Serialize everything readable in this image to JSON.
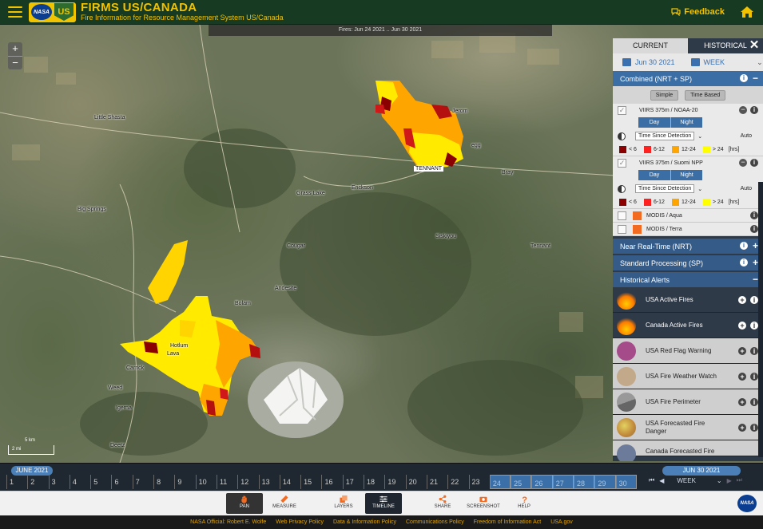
{
  "header": {
    "nasa_logo": "NASA",
    "usfs_logo": "US",
    "title": "FIRMS US/CANADA",
    "subtitle": "Fire Information for Resource Management System US/Canada",
    "feedback": "Feedback"
  },
  "map": {
    "banner": "Fires: Jun 24 2021 .. Jun 30 2021",
    "zoom_in": "+",
    "zoom_out": "−",
    "places": {
      "little_shasta": "Little Shasta",
      "jerom": "Jerom",
      "egg": "egg",
      "bray": "Bray",
      "tennant_label": "TENNANT",
      "grass_lake": "Grass Lake",
      "erickson": "Erickson",
      "big_springs": "Big Springs",
      "siskiyou": "Siskiyou",
      "tennant": "Tennant",
      "cougar": "Cougar",
      "andesite": "Andesite",
      "bolam": "Bolam",
      "hotlum": "Hotlum",
      "lava": "Lava",
      "carrick": "Carrick",
      "weed": "Weed",
      "igerna": "Igerna",
      "deetz": "Deetz"
    },
    "scale_text": "5 km",
    "scale_text2": "2 mi"
  },
  "panel": {
    "tab_current": "CURRENT",
    "tab_historical": "HISTORICAL",
    "close": "✕",
    "date": "Jun 30 2021",
    "period": "WEEK",
    "combined": "Combined (NRT + SP)",
    "btn_simple": "Simple",
    "btn_time_based": "Time Based",
    "layer1": "VIIRS 375m / NOAA-20",
    "layer2": "VIIRS 375m / Suomi NPP",
    "day": "Day",
    "night": "Night",
    "tsd": "Time Since Detection",
    "auto": "Auto",
    "legend": [
      "< 6",
      "6-12",
      "12-24",
      "> 24"
    ],
    "legend_unit": "[hrs]",
    "legend_colors": [
      "#8b0000",
      "#ff2020",
      "#ffa500",
      "#ffff00"
    ],
    "modis_aqua": "MODIS / Aqua",
    "modis_terra": "MODIS / Terra",
    "nrt": "Near Real-Time (NRT)",
    "sp": "Standard Processing (SP)",
    "hist_alerts": "Historical Alerts",
    "alerts": [
      {
        "label": "USA Active Fires"
      },
      {
        "label": "Canada Active Fires"
      },
      {
        "label": "USA Red Flag Warning"
      },
      {
        "label": "USA Fire Weather Watch"
      },
      {
        "label": "USA Fire Perimeter"
      },
      {
        "label": "USA Forecasted Fire Danger"
      },
      {
        "label": "Canada Forecasted Fire"
      }
    ]
  },
  "timeline": {
    "month": "JUNE 2021",
    "days": [
      "1",
      "2",
      "3",
      "4",
      "5",
      "6",
      "7",
      "8",
      "9",
      "10",
      "11",
      "12",
      "13",
      "14",
      "15",
      "16",
      "17",
      "18",
      "19",
      "20",
      "21",
      "22",
      "23",
      "24",
      "25",
      "26",
      "27",
      "28",
      "29",
      "30"
    ],
    "selected_from": 24,
    "date": "JUN 30 2021",
    "period": "WEEK"
  },
  "toolbar": {
    "pan": "PAN",
    "measure": "MEASURE",
    "layers": "LAYERS",
    "timeline": "TIMELINE",
    "share": "SHARE",
    "screenshot": "SCREENSHOT",
    "help": "HELP",
    "nasa": "NASA"
  },
  "footer": {
    "official": "NASA Official: Robert E. Wolfe",
    "privacy": "Web Privacy Policy",
    "data_policy": "Data & Information Policy",
    "comms": "Communications Policy",
    "foia": "Freedom of Information Act",
    "usa_gov": "USA.gov"
  }
}
